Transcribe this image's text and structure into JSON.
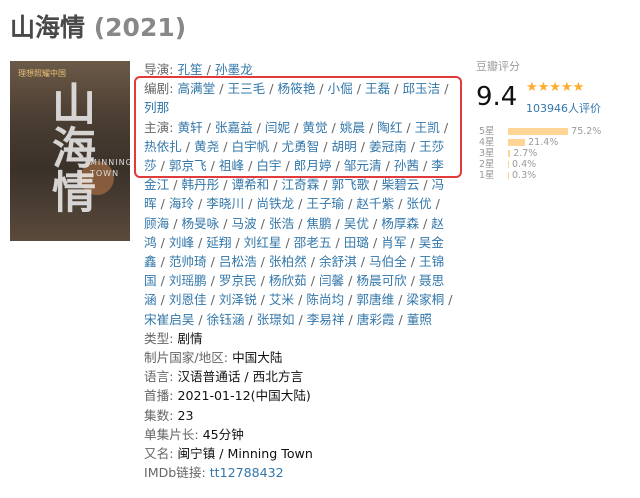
{
  "title": {
    "name": "山海情",
    "year": "(2021)"
  },
  "poster": {
    "tagline": "理想照耀中国",
    "big_text": "山海情",
    "english_lines": [
      "MINNING",
      "TOWN"
    ]
  },
  "info": {
    "director_label": "导演:",
    "directors": [
      "孔笙",
      "孙墨龙"
    ],
    "writer_label": "编剧:",
    "writers": [
      "高满堂",
      "王三毛",
      "杨筱艳",
      "小倔",
      "王磊",
      "邱玉洁",
      "列那"
    ],
    "cast_label": "主演:",
    "cast": [
      "黄轩",
      "张嘉益",
      "闫妮",
      "黄觉",
      "姚晨",
      "陶红",
      "王凯",
      "热依扎",
      "黄尧",
      "白宇帆",
      "尤勇智",
      "胡明",
      "姜冠南",
      "王莎莎",
      "郭京飞",
      "祖峰",
      "白宇",
      "郎月婷",
      "邹元清",
      "孙茜",
      "李金江",
      "韩丹彤",
      "谭希和",
      "江奇霖",
      "郭飞歌",
      "柴碧云",
      "冯晖",
      "海玲",
      "李晓川",
      "尚铁龙",
      "王子瑜",
      "赵千紫",
      "张优",
      "顾海",
      "杨旻咏",
      "马波",
      "张浩",
      "焦鹏",
      "吴优",
      "杨厚森",
      "赵鸿",
      "刘峰",
      "延翔",
      "刘红星",
      "邵老五",
      "田璐",
      "肖军",
      "吴金鑫",
      "范帅琦",
      "吕松浩",
      "张柏然",
      "余舒淇",
      "马伯全",
      "王锦国",
      "刘瑶鹏",
      "罗京民",
      "杨欣茹",
      "闫馨",
      "杨晨可欣",
      "聂思涵",
      "刘恩佳",
      "刘泽锐",
      "艾米",
      "陈尚均",
      "郭唐维",
      "梁家桐",
      "宋崔启吴",
      "徐钰涵",
      "张璟如",
      "李易祥",
      "唐彩霞",
      "董照"
    ],
    "genre_label": "类型:",
    "genre": "剧情",
    "region_label": "制片国家/地区:",
    "region": "中国大陆",
    "language_label": "语言:",
    "language": "汉语普通话 / 西北方言",
    "premiere_label": "首播:",
    "premiere": "2021-01-12(中国大陆)",
    "episodes_label": "集数:",
    "episodes": "23",
    "runtime_label": "单集片长:",
    "runtime": "45分钟",
    "aka_label": "又名:",
    "aka": "闽宁镇 / Minning Town",
    "imdb_label": "IMDb链接:",
    "imdb": "tt12788432"
  },
  "rating": {
    "header": "豆瓣评分",
    "score": "9.4",
    "stars": "★★★★★",
    "votes": "103946人评价",
    "star_color": "#ffac2d",
    "distribution": [
      {
        "label": "5星",
        "pct": "75.2%",
        "value": 75.2
      },
      {
        "label": "4星",
        "pct": "21.4%",
        "value": 21.4
      },
      {
        "label": "3星",
        "pct": "2.7%",
        "value": 2.7
      },
      {
        "label": "2星",
        "pct": "0.4%",
        "value": 0.4
      },
      {
        "label": "1星",
        "pct": "0.3%",
        "value": 0.3
      }
    ]
  }
}
